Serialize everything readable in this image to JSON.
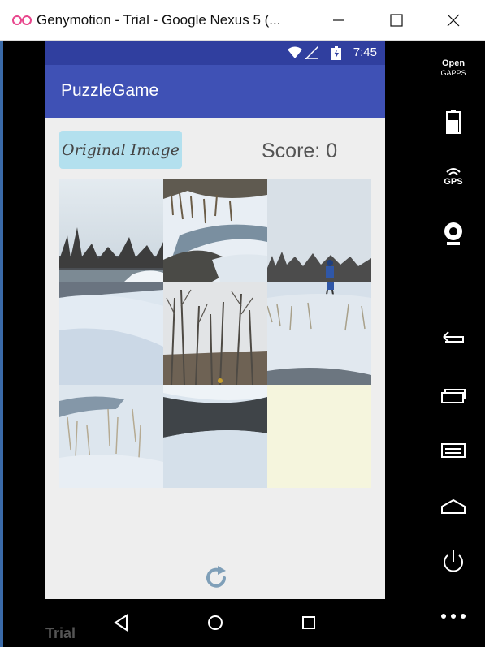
{
  "window": {
    "title": "Genymotion - Trial - Google Nexus 5 (..."
  },
  "status_bar": {
    "time": "7:45"
  },
  "app": {
    "title": "PuzzleGame",
    "original_image_button": "Original Image",
    "score_text": "Score: 0"
  },
  "puzzle": {
    "tiles": [
      {
        "position": 1,
        "scene": "sky-trees-river-top"
      },
      {
        "position": 2,
        "scene": "stream-snow-grass"
      },
      {
        "position": 3,
        "scene": "sky-hiker-top"
      },
      {
        "position": 4,
        "scene": "snow-slope"
      },
      {
        "position": 5,
        "scene": "bare-trees"
      },
      {
        "position": 6,
        "scene": "snow-field-hiker"
      },
      {
        "position": 7,
        "scene": "snow-reeds"
      },
      {
        "position": 8,
        "scene": "river-bank"
      },
      {
        "position": 9,
        "scene": "empty"
      }
    ]
  },
  "toolbar": {
    "items": [
      {
        "name": "opengapps",
        "label_line1": "Open",
        "label_line2": "GAPPS"
      },
      {
        "name": "battery",
        "label": ""
      },
      {
        "name": "gps",
        "label": "GPS"
      },
      {
        "name": "webcam",
        "label": ""
      },
      {
        "name": "back",
        "label": ""
      },
      {
        "name": "recent",
        "label": ""
      },
      {
        "name": "menu",
        "label": ""
      },
      {
        "name": "home",
        "label": ""
      },
      {
        "name": "power",
        "label": ""
      },
      {
        "name": "more",
        "label": ""
      }
    ]
  },
  "watermark": "Trial",
  "colors": {
    "status_bar": "#303f9f",
    "app_bar": "#3f51b5",
    "button": "#b3e0ee",
    "empty_tile": "#f5f5dd",
    "refresh_icon": "#7f9fb8"
  }
}
